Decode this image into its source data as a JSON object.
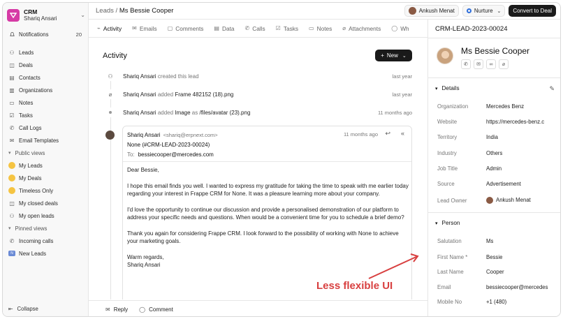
{
  "brand": {
    "name": "CRM",
    "user": "Shariq Ansari"
  },
  "sidebar": {
    "notifications": {
      "label": "Notifications",
      "count": "20"
    },
    "items": [
      {
        "label": "Leads",
        "icon": "leads-icon"
      },
      {
        "label": "Deals",
        "icon": "deals-icon"
      },
      {
        "label": "Contacts",
        "icon": "contacts-icon"
      },
      {
        "label": "Organizations",
        "icon": "organizations-icon"
      },
      {
        "label": "Notes",
        "icon": "notes-icon"
      },
      {
        "label": "Tasks",
        "icon": "tasks-icon"
      },
      {
        "label": "Call Logs",
        "icon": "call-logs-icon"
      },
      {
        "label": "Email Templates",
        "icon": "email-templates-icon"
      }
    ],
    "public_views_label": "Public views",
    "public_views": [
      "My Leads",
      "My Deals",
      "Timeless Only",
      "My closed deals",
      "My open leads"
    ],
    "pinned_views_label": "Pinned views",
    "pinned_views": [
      "Incoming calls",
      "New Leads"
    ],
    "collapse_label": "Collapse"
  },
  "header": {
    "breadcrumb_parent": "Leads",
    "breadcrumb_sep": "/",
    "breadcrumb_current": "Ms Bessie Cooper",
    "owner": "Ankush Menat",
    "status": "Nurture",
    "convert_label": "Convert to Deal"
  },
  "tabs": [
    "Activity",
    "Emails",
    "Comments",
    "Data",
    "Calls",
    "Tasks",
    "Notes",
    "Attachments",
    "Wh"
  ],
  "activity": {
    "title": "Activity",
    "new_label": "New",
    "events": [
      {
        "actor": "Shariq Ansari",
        "action": "created this lead",
        "when": "last year"
      },
      {
        "actor": "Shariq Ansari",
        "action": "added",
        "object": "Frame 482152 (18).png",
        "when": "last year"
      },
      {
        "actor": "Shariq Ansari",
        "action": "added",
        "object": "Image",
        "as": "as",
        "target": "/files/avatar (23).png",
        "when": "11 months ago"
      }
    ],
    "email": {
      "from_name": "Shariq Ansari",
      "from_addr": "<shariq@erpnext.com>",
      "when": "11 months ago",
      "subject": "None (#CRM-LEAD-2023-00024)",
      "to_label": "To:",
      "to": "bessiecooper@mercedes.com",
      "body": [
        "Dear Bessie,",
        "I hope this email finds you well. I wanted to express my gratitude for taking the time to speak with me earlier today regarding your interest in Frappe CRM for None. It was a pleasure learning more about your company.",
        "I'd love the opportunity to continue our discussion and provide a personalised demonstration of our platform to address your specific needs and questions. When would be a convenient time for you to schedule a brief demo?",
        "Thank you again for considering Frappe CRM. I look forward to the possibility of working with None to achieve your marketing goals.",
        "Warm regards,"
      ],
      "signature": "Shariq Ansari"
    }
  },
  "footer": {
    "reply_label": "Reply",
    "comment_label": "Comment"
  },
  "panel": {
    "lead_id": "CRM-LEAD-2023-00024",
    "name": "Ms Bessie Cooper",
    "details_label": "Details",
    "details": [
      {
        "label": "Organization",
        "value": "Mercedes Benz"
      },
      {
        "label": "Website",
        "value": "https://mercedes-benz.c"
      },
      {
        "label": "Territory",
        "value": "India"
      },
      {
        "label": "Industry",
        "value": "Others"
      },
      {
        "label": "Job Title",
        "value": "Admin"
      },
      {
        "label": "Source",
        "value": "Advertisement"
      },
      {
        "label": "Lead Owner",
        "value": "Ankush Menat"
      }
    ],
    "person_label": "Person",
    "person": [
      {
        "label": "Salutation",
        "value": "Ms"
      },
      {
        "label": "First Name *",
        "value": "Bessie"
      },
      {
        "label": "Last Name",
        "value": "Cooper"
      },
      {
        "label": "Email",
        "value": "bessiecooper@mercedes"
      },
      {
        "label": "Mobile No",
        "value": "+1 (480)"
      }
    ]
  },
  "annotation": {
    "text": "Less flexible UI",
    "color": "#d84040"
  }
}
